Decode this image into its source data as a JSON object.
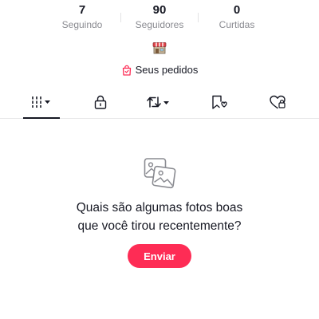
{
  "stats": [
    {
      "value": "7",
      "label": "Seguindo"
    },
    {
      "value": "90",
      "label": "Seguidores"
    },
    {
      "value": "0",
      "label": "Curtidas"
    }
  ],
  "shop": {
    "icon": "storefront-icon"
  },
  "orders": {
    "label": "Seus pedidos",
    "icon": "shopping-bag-icon"
  },
  "tabs": [
    {
      "icon": "grid-videos-icon",
      "selected": true,
      "has_dropdown": true
    },
    {
      "icon": "lock-icon",
      "selected": false
    },
    {
      "icon": "repost-icon",
      "selected": false,
      "has_dropdown": true
    },
    {
      "icon": "favorites-icon",
      "selected": false
    },
    {
      "icon": "liked-heart-icon",
      "selected": false
    }
  ],
  "empty_state": {
    "icon": "photos-icon",
    "line1": "Quais são algumas fotos boas",
    "line2": "que você tirou recentemente?",
    "button_label": "Enviar"
  },
  "colors": {
    "accent": "#fe2c55",
    "text": "#161823",
    "muted": "#8a8b91"
  }
}
